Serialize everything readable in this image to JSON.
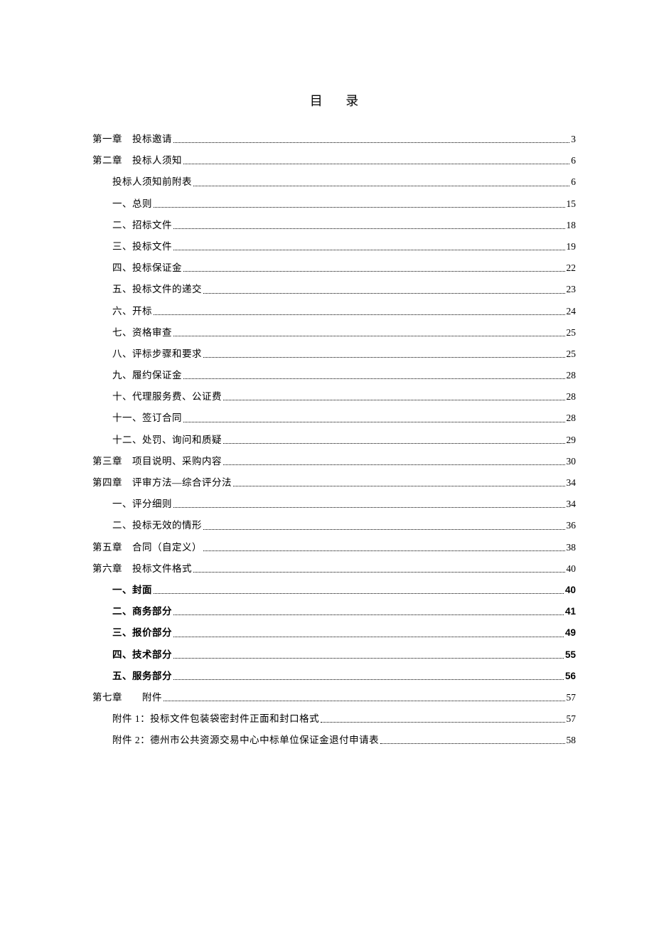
{
  "title": "目 录",
  "toc": [
    {
      "level": 0,
      "bold": false,
      "label": "第一章　投标邀请",
      "page": "3"
    },
    {
      "level": 0,
      "bold": false,
      "label": "第二章　投标人须知",
      "page": "6"
    },
    {
      "level": 1,
      "bold": false,
      "label": "投标人须知前附表",
      "page": "6"
    },
    {
      "level": 1,
      "bold": false,
      "label": "一、总则",
      "page": "15"
    },
    {
      "level": 1,
      "bold": false,
      "label": "二、招标文件",
      "page": "18"
    },
    {
      "level": 1,
      "bold": false,
      "label": "三、投标文件",
      "page": "19"
    },
    {
      "level": 1,
      "bold": false,
      "label": "四、投标保证金",
      "page": "22"
    },
    {
      "level": 1,
      "bold": false,
      "label": "五、投标文件的递交",
      "page": "23"
    },
    {
      "level": 1,
      "bold": false,
      "label": "六、开标",
      "page": "24"
    },
    {
      "level": 1,
      "bold": false,
      "label": "七、资格审查",
      "page": "25"
    },
    {
      "level": 1,
      "bold": false,
      "label": "八、评标步骤和要求",
      "page": "25"
    },
    {
      "level": 1,
      "bold": false,
      "label": "九、履约保证金",
      "page": "28"
    },
    {
      "level": 1,
      "bold": false,
      "label": "十、代理服务费、公证费",
      "page": "28"
    },
    {
      "level": 1,
      "bold": false,
      "label": "十一、签订合同",
      "page": "28"
    },
    {
      "level": 1,
      "bold": false,
      "label": "十二、处罚、询问和质疑",
      "page": "29"
    },
    {
      "level": 0,
      "bold": false,
      "label": "第三章　项目说明、采购内容",
      "page": "30"
    },
    {
      "level": 0,
      "bold": false,
      "label": "第四章　评审方法—综合评分法",
      "page": "34"
    },
    {
      "level": 1,
      "bold": false,
      "label": "一、评分细则",
      "page": "34"
    },
    {
      "level": 1,
      "bold": false,
      "label": "二、投标无效的情形",
      "page": "36"
    },
    {
      "level": 0,
      "bold": false,
      "label": "第五章　合同（自定义）",
      "page": "38"
    },
    {
      "level": 0,
      "bold": false,
      "label": "第六章　投标文件格式",
      "page": "40"
    },
    {
      "level": 1,
      "bold": true,
      "label": "一、封面",
      "page": "40"
    },
    {
      "level": 1,
      "bold": true,
      "label": "二、商务部分",
      "page": "41"
    },
    {
      "level": 1,
      "bold": true,
      "label": "三、报价部分",
      "page": "49"
    },
    {
      "level": 1,
      "bold": true,
      "label": "四、技术部分",
      "page": "55"
    },
    {
      "level": 1,
      "bold": true,
      "label": "五、服务部分",
      "page": "56"
    },
    {
      "level": 0,
      "bold": false,
      "label": "第七章　　附件",
      "page": "57"
    },
    {
      "level": 1,
      "bold": false,
      "label": "附件 1：投标文件包装袋密封件正面和封口格式",
      "page": "57"
    },
    {
      "level": 1,
      "bold": false,
      "label": "附件 2：德州市公共资源交易中心中标单位保证金退付申请表",
      "page": "58"
    }
  ]
}
